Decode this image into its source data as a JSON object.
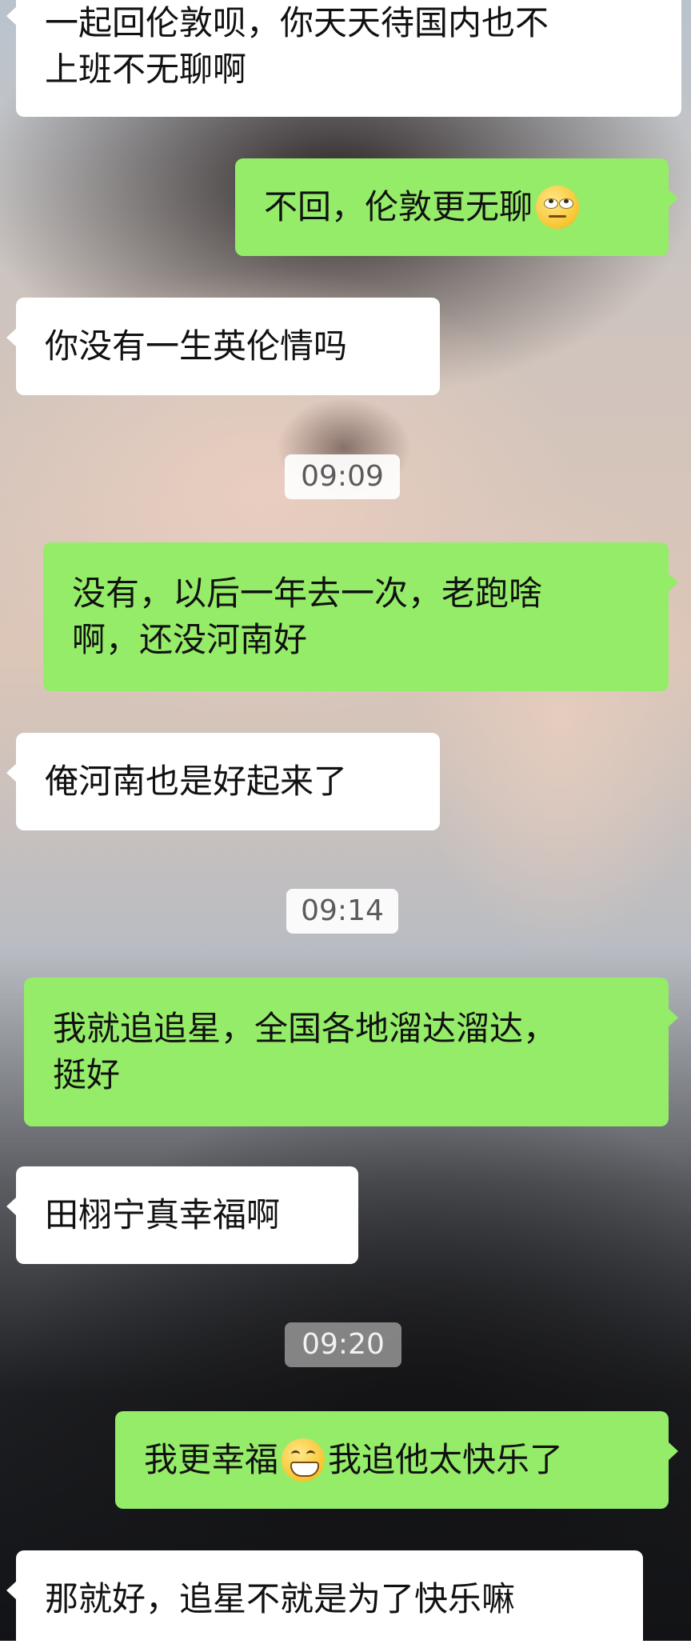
{
  "messages": [
    {
      "side": "left",
      "text": "一起回伦敦呗，你天天待国内也不\n上班不无聊啊"
    },
    {
      "side": "right",
      "text": "不回，伦敦更无聊",
      "emoji": "face-with-rolling-eyes"
    },
    {
      "side": "left",
      "text": "你没有一生英伦情吗"
    },
    {
      "time": "09:09"
    },
    {
      "side": "right",
      "text": "没有，以后一年去一次，老跑啥\n啊，还没河南好"
    },
    {
      "side": "left",
      "text": "俺河南也是好起来了"
    },
    {
      "time": "09:14"
    },
    {
      "side": "right",
      "text": "我就追追星，全国各地溜达溜达，\n挺好"
    },
    {
      "side": "left",
      "text": "田栩宁真幸福啊"
    },
    {
      "time": "09:20"
    },
    {
      "side": "right",
      "text_before": "我更幸福",
      "emoji": "grinning-face",
      "text_after": "我追他太快乐了"
    },
    {
      "side": "left",
      "text": "那就好，追星不就是为了快乐嘛"
    }
  ]
}
